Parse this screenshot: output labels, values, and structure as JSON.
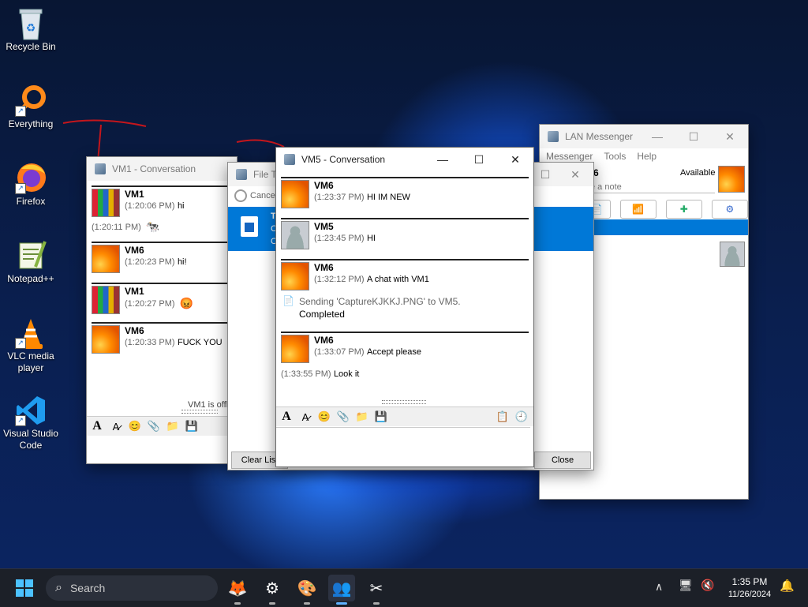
{
  "desktop": {
    "icons": [
      {
        "label": "Recycle Bin"
      },
      {
        "label": "Everything"
      },
      {
        "label": "Firefox"
      },
      {
        "label": "Notepad++"
      },
      {
        "label": "VLC media player"
      },
      {
        "label": "Visual Studio Code"
      }
    ]
  },
  "vm1_window": {
    "title": "VM1 - Conversation",
    "messages": [
      {
        "sender": "VM1",
        "time": "(1:20:06 PM)",
        "text": "hi"
      },
      {
        "time": "(1:20:11 PM)",
        "text": ""
      },
      {
        "sender": "VM6",
        "time": "(1:20:23 PM)",
        "text": "hi!"
      },
      {
        "sender": "VM1",
        "time": "(1:20:27 PM)",
        "text": ""
      },
      {
        "sender": "VM6",
        "time": "(1:20:33 PM)",
        "text": "FUCK YOU"
      }
    ],
    "status": "VM1 is offl"
  },
  "file_transfer_window": {
    "title": "File Tr",
    "cancel_label": "Cancel",
    "row_letters": [
      "T",
      "C",
      "C"
    ],
    "clear_list_label": "Clear List",
    "close_label": "Close"
  },
  "vm5_window": {
    "title": "VM5 - Conversation",
    "messages": [
      {
        "sender": "VM6",
        "time": "(1:23:37 PM)",
        "text": "HI IM NEW"
      },
      {
        "sender": "VM5",
        "time": "(1:23:45 PM)",
        "text": "HI"
      },
      {
        "sender": "VM6",
        "time": "(1:32:12 PM)",
        "text": "A chat with VM1"
      }
    ],
    "file_notice": {
      "text": "Sending 'CaptureKJKKJ.PNG' to VM5.",
      "status": "Completed"
    },
    "messages_after": [
      {
        "sender": "VM6",
        "time": "(1:33:07 PM)",
        "text": "Accept please"
      }
    ],
    "continuation": {
      "time": "(1:33:55 PM)",
      "text": "Look it"
    },
    "input_value": ""
  },
  "lan_messenger": {
    "title": "LAN Messenger",
    "menu": [
      "Messenger",
      "Tools",
      "Help"
    ],
    "user_name_partial": "6",
    "status": "Available",
    "note_placeholder": "e a note"
  },
  "taskbar": {
    "search_label": "Search",
    "time": "1:35 PM",
    "date": "11/26/2024"
  },
  "colors": {
    "selection_blue": "#0078d7",
    "desktop_blue": "#1247d6",
    "taskbar_bg": "#1c2028"
  }
}
